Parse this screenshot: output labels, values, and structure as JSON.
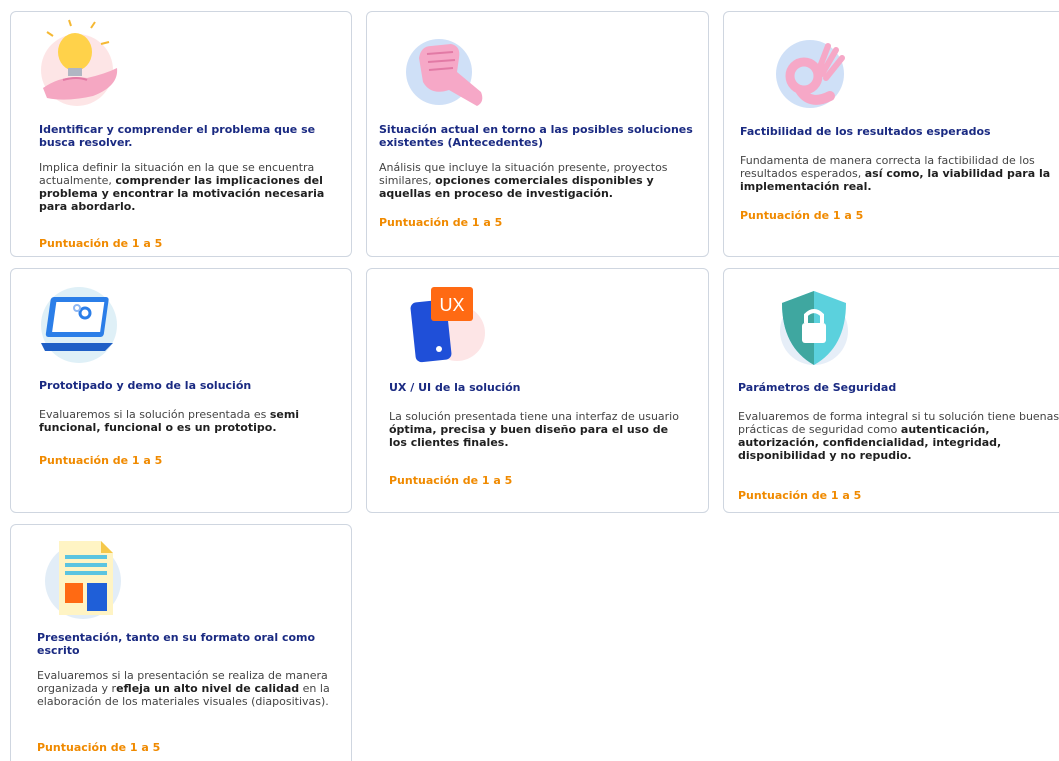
{
  "cards": [
    {
      "title": "Identificar y comprender el problema que se busca resolver.",
      "desc_plain_1": "Implica definir la situación en la que se encuentra actualmente, ",
      "desc_bold_1": "comprender las implicaciones del problema y encontrar la motivación necesaria para abordarlo.",
      "score": "Puntuación de 1 a 5",
      "icon": "lightbulb-hand-icon"
    },
    {
      "title": "Situación actual en torno a las posibles soluciones existentes (Antecedentes)",
      "desc_plain_1": "Análisis que incluye la situación presente, proyectos similares, ",
      "desc_bold_1": "opciones comerciales disponibles y aquellas en proceso de investigación.",
      "score": "Puntuación de 1 a 5",
      "icon": "fist-hand-icon"
    },
    {
      "title": "Factibilidad de los resultados esperados",
      "desc_plain_1": "Fundamenta de manera correcta la factibilidad de los resultados esperados, ",
      "desc_bold_1": "así como, la viabilidad para la implementación real.",
      "score": "Puntuación de 1 a 5",
      "icon": "ok-hand-icon"
    },
    {
      "title": "Prototipado y demo de la solución",
      "desc_plain_1": "Evaluaremos si la solución presentada es ",
      "desc_bold_1": "semi funcional, funcional o es un prototipo.",
      "score": "Puntuación de 1 a 5",
      "icon": "laptop-gear-icon"
    },
    {
      "title": "UX / UI de la solución",
      "desc_plain_1": "La solución presentada tiene una interfaz de usuario ",
      "desc_bold_1": "óptima, precisa y buen diseño para el uso de los clientes finales.",
      "score": "Puntuación de 1 a 5",
      "icon": "ux-phone-icon",
      "icon_text": "UX"
    },
    {
      "title": "Parámetros de Seguridad",
      "desc_plain_1": "Evaluaremos de forma integral si tu solución tiene buenas prácticas de seguridad como ",
      "desc_bold_1": "autenticación, autorización, confidencialidad, integridad, disponibilidad y no repudio.",
      "score": "Puntuación de 1 a 5",
      "icon": "shield-lock-icon"
    },
    {
      "title": "Presentación, tanto en su formato oral como escrito",
      "desc_plain_1": "Evaluaremos si la presentación se realiza de manera organizada y r",
      "desc_bold_1": "efleja un alto nivel de calidad",
      "desc_plain_2": " en la elaboración de los materiales visuales (diapositivas).",
      "score": "Puntuación de 1 a 5",
      "icon": "document-icon"
    }
  ]
}
